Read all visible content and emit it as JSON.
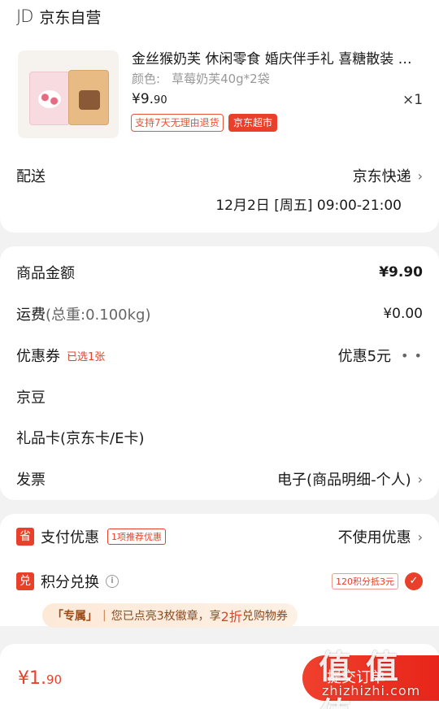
{
  "shop": {
    "logo": "JD",
    "name": "京东自营"
  },
  "product": {
    "title": "金丝猴奶芙 休闲零食 婚庆伴手礼 喜糖散装 糖果",
    "attr_key": "颜色:",
    "attr_value": "草莓奶芙40g*2袋",
    "price_main": "¥9.",
    "price_dec": "90",
    "qty": "×1",
    "tag_return": "支持7天无理由退货",
    "tag_store": "京东超市"
  },
  "delivery": {
    "label": "配送",
    "method": "京东快递",
    "time": "12月2日 [周五] 09:00-21:00"
  },
  "fees": {
    "goods_label": "商品金额",
    "goods_value": "¥9.90",
    "shipping_label": "运费",
    "shipping_weight": "(总重:0.100kg)",
    "shipping_value": "¥0.00",
    "coupon_label": "优惠券",
    "coupon_selected": "已选1张",
    "coupon_value": "优惠5元",
    "coupon_more": "• •",
    "jingdou_label": "京豆",
    "giftcard_label": "礼品卡(京东卡/E卡)",
    "invoice_label": "发票",
    "invoice_value": "电子(商品明细-个人)"
  },
  "payment": {
    "icon_char": "省",
    "label": "支付优惠",
    "recommend_tag": "1项推荐优惠",
    "value": "不使用优惠"
  },
  "points": {
    "icon_char": "兑",
    "label": "积分兑换",
    "info_char": "i",
    "tag": "120积分抵3元",
    "check_char": "✓"
  },
  "banner": {
    "exclusive": "「专属」",
    "sep": "|",
    "text_pre": "您已点亮3枚徽章，享",
    "highlight": "2折",
    "text_post": "兑购物券"
  },
  "footer": {
    "total_main": "¥1.",
    "total_dec": "90",
    "submit_label": "提交订单",
    "watermark": "值 值 值",
    "watermark_url": "zhizhizhi.com"
  },
  "chevron": "›",
  "colors": {
    "accent": "#e8402a",
    "background": "#f2f2f2"
  }
}
